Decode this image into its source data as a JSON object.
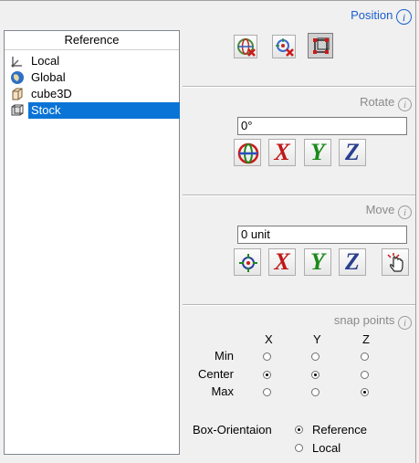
{
  "reference": {
    "header": "Reference",
    "items": [
      {
        "label": "Local",
        "icon": "local-axes-icon",
        "selected": false
      },
      {
        "label": "Global",
        "icon": "globe-icon",
        "selected": false
      },
      {
        "label": "cube3D",
        "icon": "cube-icon",
        "selected": false
      },
      {
        "label": "Stock",
        "icon": "stock-box-icon",
        "selected": true
      }
    ]
  },
  "position": {
    "title": "Position",
    "info_icon": "info-icon",
    "buttons": [
      "globe-remove-icon",
      "target-remove-icon",
      "box-snap-icon"
    ],
    "pressed": "box-snap-icon"
  },
  "rotate": {
    "title": "Rotate",
    "value": "0°",
    "buttons": [
      {
        "icon": "globe-rotate-icon"
      },
      {
        "label": "X",
        "color": "#c01818"
      },
      {
        "label": "Y",
        "color": "#1a8a1a"
      },
      {
        "label": "Z",
        "color": "#2a3f8f"
      }
    ]
  },
  "move": {
    "title": "Move",
    "value": "0 unit",
    "buttons": [
      {
        "icon": "target-icon"
      },
      {
        "label": "X",
        "color": "#c01818"
      },
      {
        "label": "Y",
        "color": "#1a8a1a"
      },
      {
        "label": "Z",
        "color": "#2a3f8f"
      },
      {
        "icon": "hand-pointer-icon"
      }
    ]
  },
  "snap": {
    "title": "snap points",
    "columns": [
      "X",
      "Y",
      "Z"
    ],
    "rows": [
      {
        "label": "Min",
        "selected": []
      },
      {
        "label": "Center",
        "selected": [
          "X",
          "Y"
        ]
      },
      {
        "label": "Max",
        "selected": [
          "Z"
        ]
      }
    ]
  },
  "box_orientation": {
    "label": "Box-Orientaion",
    "options": [
      "Reference",
      "Local"
    ],
    "selected": "Reference"
  }
}
